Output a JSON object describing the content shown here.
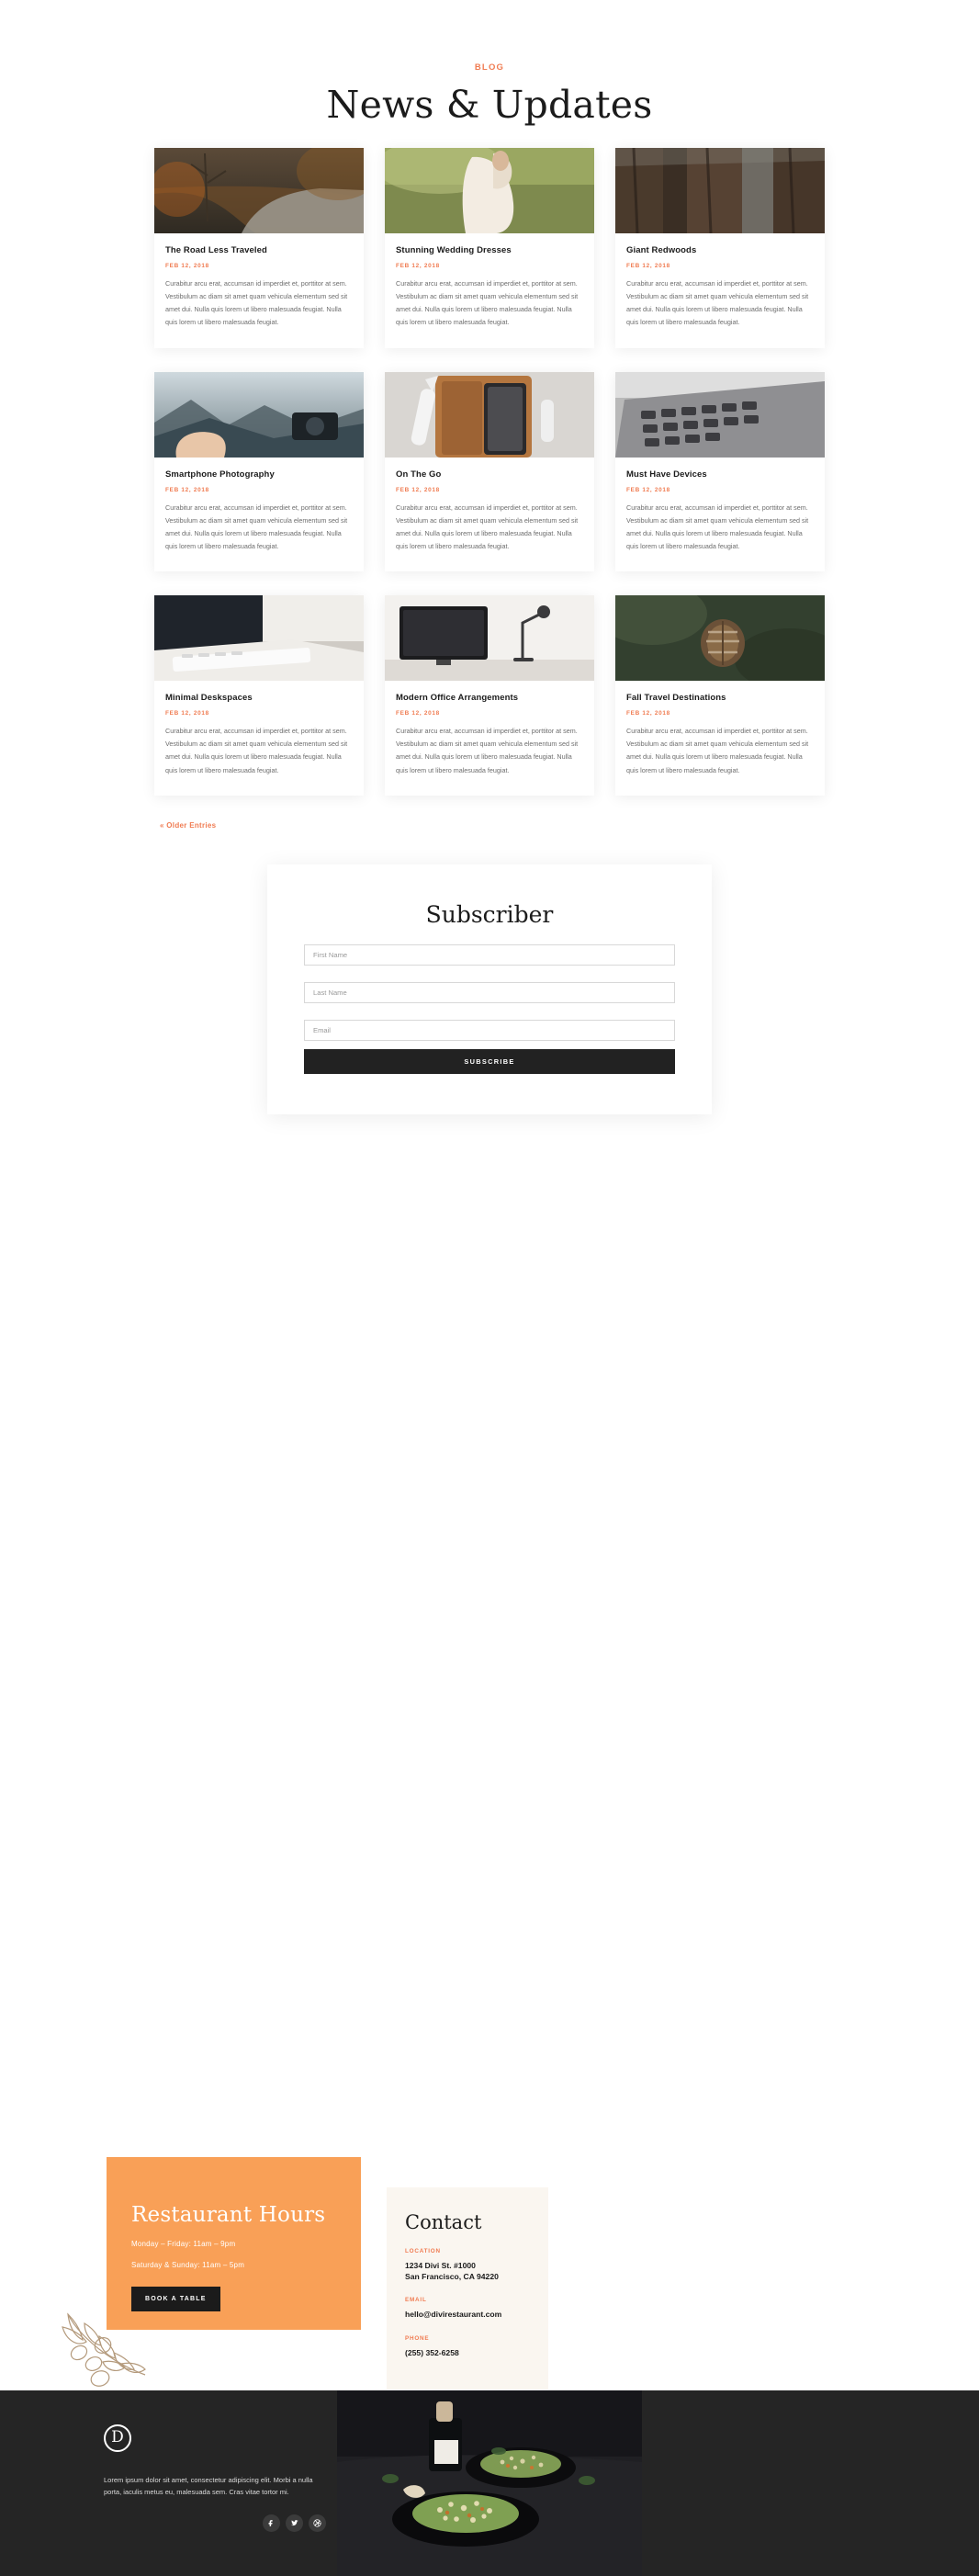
{
  "colors": {
    "accent": "#f07c52",
    "orange_block": "#f9a057",
    "dark": "#252525",
    "cream": "#faf6f0"
  },
  "blog": {
    "eyebrow": "BLOG",
    "title": "News & Updates",
    "older_entries": "« Older Entries",
    "posts": [
      {
        "title": "The Road Less Traveled",
        "date": "FEB 12, 2018",
        "excerpt": "Curabitur arcu erat, accumsan id imperdiet et, porttitor at sem. Vestibulum ac diam sit amet quam vehicula elementum sed sit amet dui. Nulla quis lorem ut libero malesuada feugiat. Nulla quis lorem ut libero malesuada feugiat.",
        "image": "autumn-forest-road"
      },
      {
        "title": "Stunning Wedding Dresses",
        "date": "FEB 12, 2018",
        "excerpt": "Curabitur arcu erat, accumsan id imperdiet et, porttitor at sem. Vestibulum ac diam sit amet quam vehicula elementum sed sit amet dui. Nulla quis lorem ut libero malesuada feugiat. Nulla quis lorem ut libero malesuada feugiat.",
        "image": "bride-in-white-dress"
      },
      {
        "title": "Giant Redwoods",
        "date": "FEB 12, 2018",
        "excerpt": "Curabitur arcu erat, accumsan id imperdiet et, porttitor at sem. Vestibulum ac diam sit amet quam vehicula elementum sed sit amet dui. Nulla quis lorem ut libero malesuada feugiat. Nulla quis lorem ut libero malesuada feugiat.",
        "image": "redwood-tree-trunks"
      },
      {
        "title": "Smartphone Photography",
        "date": "FEB 12, 2018",
        "excerpt": "Curabitur arcu erat, accumsan id imperdiet et, porttitor at sem. Vestibulum ac diam sit amet quam vehicula elementum sed sit amet dui. Nulla quis lorem ut libero malesuada feugiat. Nulla quis lorem ut libero malesuada feugiat.",
        "image": "hands-holding-camera-mountains"
      },
      {
        "title": "On The Go",
        "date": "FEB 12, 2018",
        "excerpt": "Curabitur arcu erat, accumsan id imperdiet et, porttitor at sem. Vestibulum ac diam sit amet quam vehicula elementum sed sit amet dui. Nulla quis lorem ut libero malesuada feugiat. Nulla quis lorem ut libero malesuada feugiat.",
        "image": "leather-case-phone-stylus"
      },
      {
        "title": "Must Have Devices",
        "date": "FEB 12, 2018",
        "excerpt": "Curabitur arcu erat, accumsan id imperdiet et, porttitor at sem. Vestibulum ac diam sit amet quam vehicula elementum sed sit amet dui. Nulla quis lorem ut libero malesuada feugiat. Nulla quis lorem ut libero malesuada feugiat.",
        "image": "laptop-keyboard-closeup"
      },
      {
        "title": "Minimal Deskspaces",
        "date": "FEB 12, 2018",
        "excerpt": "Curabitur arcu erat, accumsan id imperdiet et, porttitor at sem. Vestibulum ac diam sit amet quam vehicula elementum sed sit amet dui. Nulla quis lorem ut libero malesuada feugiat. Nulla quis lorem ut libero malesuada feugiat.",
        "image": "white-keyboard-on-desk"
      },
      {
        "title": "Modern Office Arrangements",
        "date": "FEB 12, 2018",
        "excerpt": "Curabitur arcu erat, accumsan id imperdiet et, porttitor at sem. Vestibulum ac diam sit amet quam vehicula elementum sed sit amet dui. Nulla quis lorem ut libero malesuada feugiat. Nulla quis lorem ut libero malesuada feugiat.",
        "image": "monitor-and-desk-lamp"
      },
      {
        "title": "Fall Travel Destinations",
        "date": "FEB 12, 2018",
        "excerpt": "Curabitur arcu erat, accumsan id imperdiet et, porttitor at sem. Vestibulum ac diam sit amet quam vehicula elementum sed sit amet dui. Nulla quis lorem ut libero malesuada feugiat. Nulla quis lorem ut libero malesuada feugiat.",
        "image": "pine-cone-on-moss"
      }
    ]
  },
  "subscribe": {
    "title": "Subscriber",
    "first_name_placeholder": "First Name",
    "first_name_value": "",
    "last_name_placeholder": "Last Name",
    "last_name_value": "",
    "email_placeholder": "Email",
    "email_value": "",
    "button_label": "SUBSCRIBE"
  },
  "hours": {
    "title": "Restaurant Hours",
    "weekday": "Monday – Friday: 11am – 9pm",
    "weekend": "Saturday & Sunday: 11am – 5pm",
    "button_label": "BOOK A TABLE"
  },
  "contact": {
    "title": "Contact",
    "location_label": "LOCATION",
    "address_line1": "1234 Divi St. #1000",
    "address_line2": "San Francisco, CA 94220",
    "email_label": "EMAIL",
    "email": "hello@divirestaurant.com",
    "phone_label": "PHONE",
    "phone": "(255) 352-6258"
  },
  "footer": {
    "logo_letter": "D",
    "text": "Lorem ipsum dolor sit amet, consectetur adipiscing elit. Morbi a nulla porta, iaculis metus eu, malesuada sem. Cras vitae tortor mi.",
    "socials": [
      "facebook-icon",
      "twitter-icon",
      "dribbble-icon"
    ],
    "image": "plated-salad-dark-table"
  },
  "decor": {
    "olive_branch": "olive-branch-illustration"
  }
}
